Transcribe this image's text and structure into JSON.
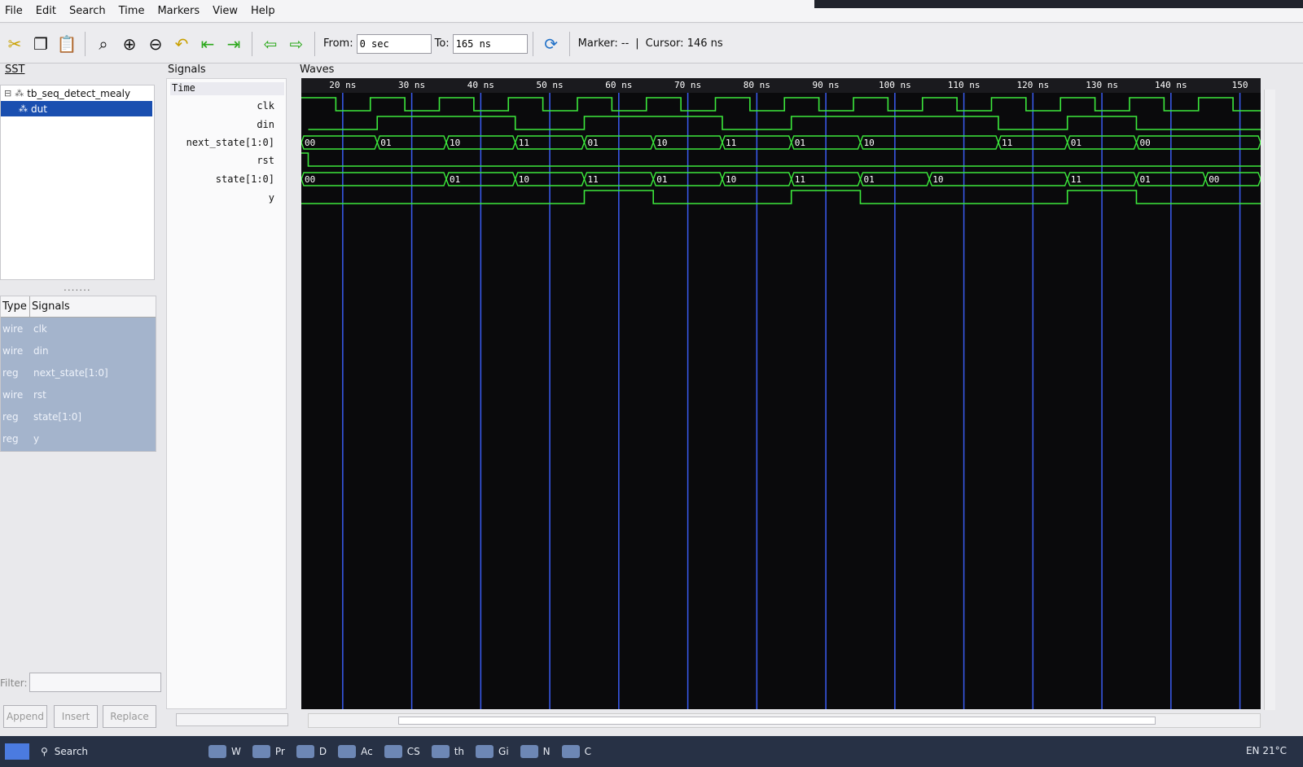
{
  "menu": [
    "File",
    "Edit",
    "Search",
    "Time",
    "Markers",
    "View",
    "Help"
  ],
  "toolbar": {
    "from_label": "From:",
    "from_value": "0 sec",
    "to_label": "To:",
    "to_value": "165 ns",
    "marker_text": "Marker: --",
    "separator": "|",
    "cursor_text": "Cursor: 146 ns"
  },
  "sst": {
    "title": "SST",
    "tree": [
      {
        "label": "tb_seq_detect_mealy"
      },
      {
        "label": "dut"
      }
    ],
    "splitter": ".......",
    "signals_table": {
      "headers": [
        "Type",
        "Signals"
      ],
      "rows": [
        {
          "type": "wire",
          "name": "clk"
        },
        {
          "type": "wire",
          "name": "din"
        },
        {
          "type": "reg",
          "name": "next_state[1:0]"
        },
        {
          "type": "wire",
          "name": "rst"
        },
        {
          "type": "reg",
          "name": "state[1:0]"
        },
        {
          "type": "reg",
          "name": "y"
        }
      ]
    },
    "filter_label": "Filter:",
    "buttons": [
      "Append",
      "Insert",
      "Replace"
    ]
  },
  "signals_pane": {
    "title": "Signals",
    "time_header": "Time",
    "names": [
      "clk",
      "din",
      "next_state[1:0]",
      "rst",
      "state[1:0]",
      "y"
    ]
  },
  "waves": {
    "title": "Waves",
    "time_unit": "ns",
    "ruler_labels": [
      "20 ns",
      "30 ns",
      "40 ns",
      "50 ns",
      "60 ns",
      "70 ns",
      "80 ns",
      "90 ns",
      "100 ns",
      "110 ns",
      "120 ns",
      "130 ns",
      "140 ns",
      "150"
    ],
    "clock_period_ns": 10,
    "din": [
      [
        15,
        0
      ],
      [
        25,
        1
      ],
      [
        45,
        0
      ],
      [
        55,
        1
      ],
      [
        75,
        0
      ],
      [
        85,
        1
      ],
      [
        115,
        0
      ],
      [
        125,
        1
      ],
      [
        135,
        0
      ]
    ],
    "next_state": [
      [
        14,
        "00"
      ],
      [
        25,
        "01"
      ],
      [
        35,
        "10"
      ],
      [
        45,
        "11"
      ],
      [
        55,
        "01"
      ],
      [
        65,
        "10"
      ],
      [
        75,
        "11"
      ],
      [
        85,
        "01"
      ],
      [
        95,
        "10"
      ],
      [
        115,
        "11"
      ],
      [
        125,
        "01"
      ],
      [
        135,
        "00"
      ]
    ],
    "state": [
      [
        14,
        "00"
      ],
      [
        35,
        "01"
      ],
      [
        45,
        "10"
      ],
      [
        55,
        "11"
      ],
      [
        65,
        "01"
      ],
      [
        75,
        "10"
      ],
      [
        85,
        "11"
      ],
      [
        95,
        "01"
      ],
      [
        105,
        "10"
      ],
      [
        125,
        "11"
      ],
      [
        135,
        "01"
      ],
      [
        145,
        "00"
      ]
    ],
    "y": [
      [
        14,
        0
      ],
      [
        55,
        1
      ],
      [
        65,
        0
      ],
      [
        85,
        1
      ],
      [
        95,
        0
      ],
      [
        125,
        1
      ],
      [
        135,
        0
      ]
    ],
    "colors": {
      "background": "#0a0a0c",
      "trace": "#3ce83c",
      "gridline": "#3a5cf2",
      "ruler": "#ffffff"
    }
  },
  "taskbar": {
    "search_label": "Search",
    "items": [
      "W",
      "Pr",
      "D",
      "Ac",
      "CS",
      "th",
      "Gi",
      "N",
      "C"
    ],
    "tray": "EN   21°C"
  }
}
